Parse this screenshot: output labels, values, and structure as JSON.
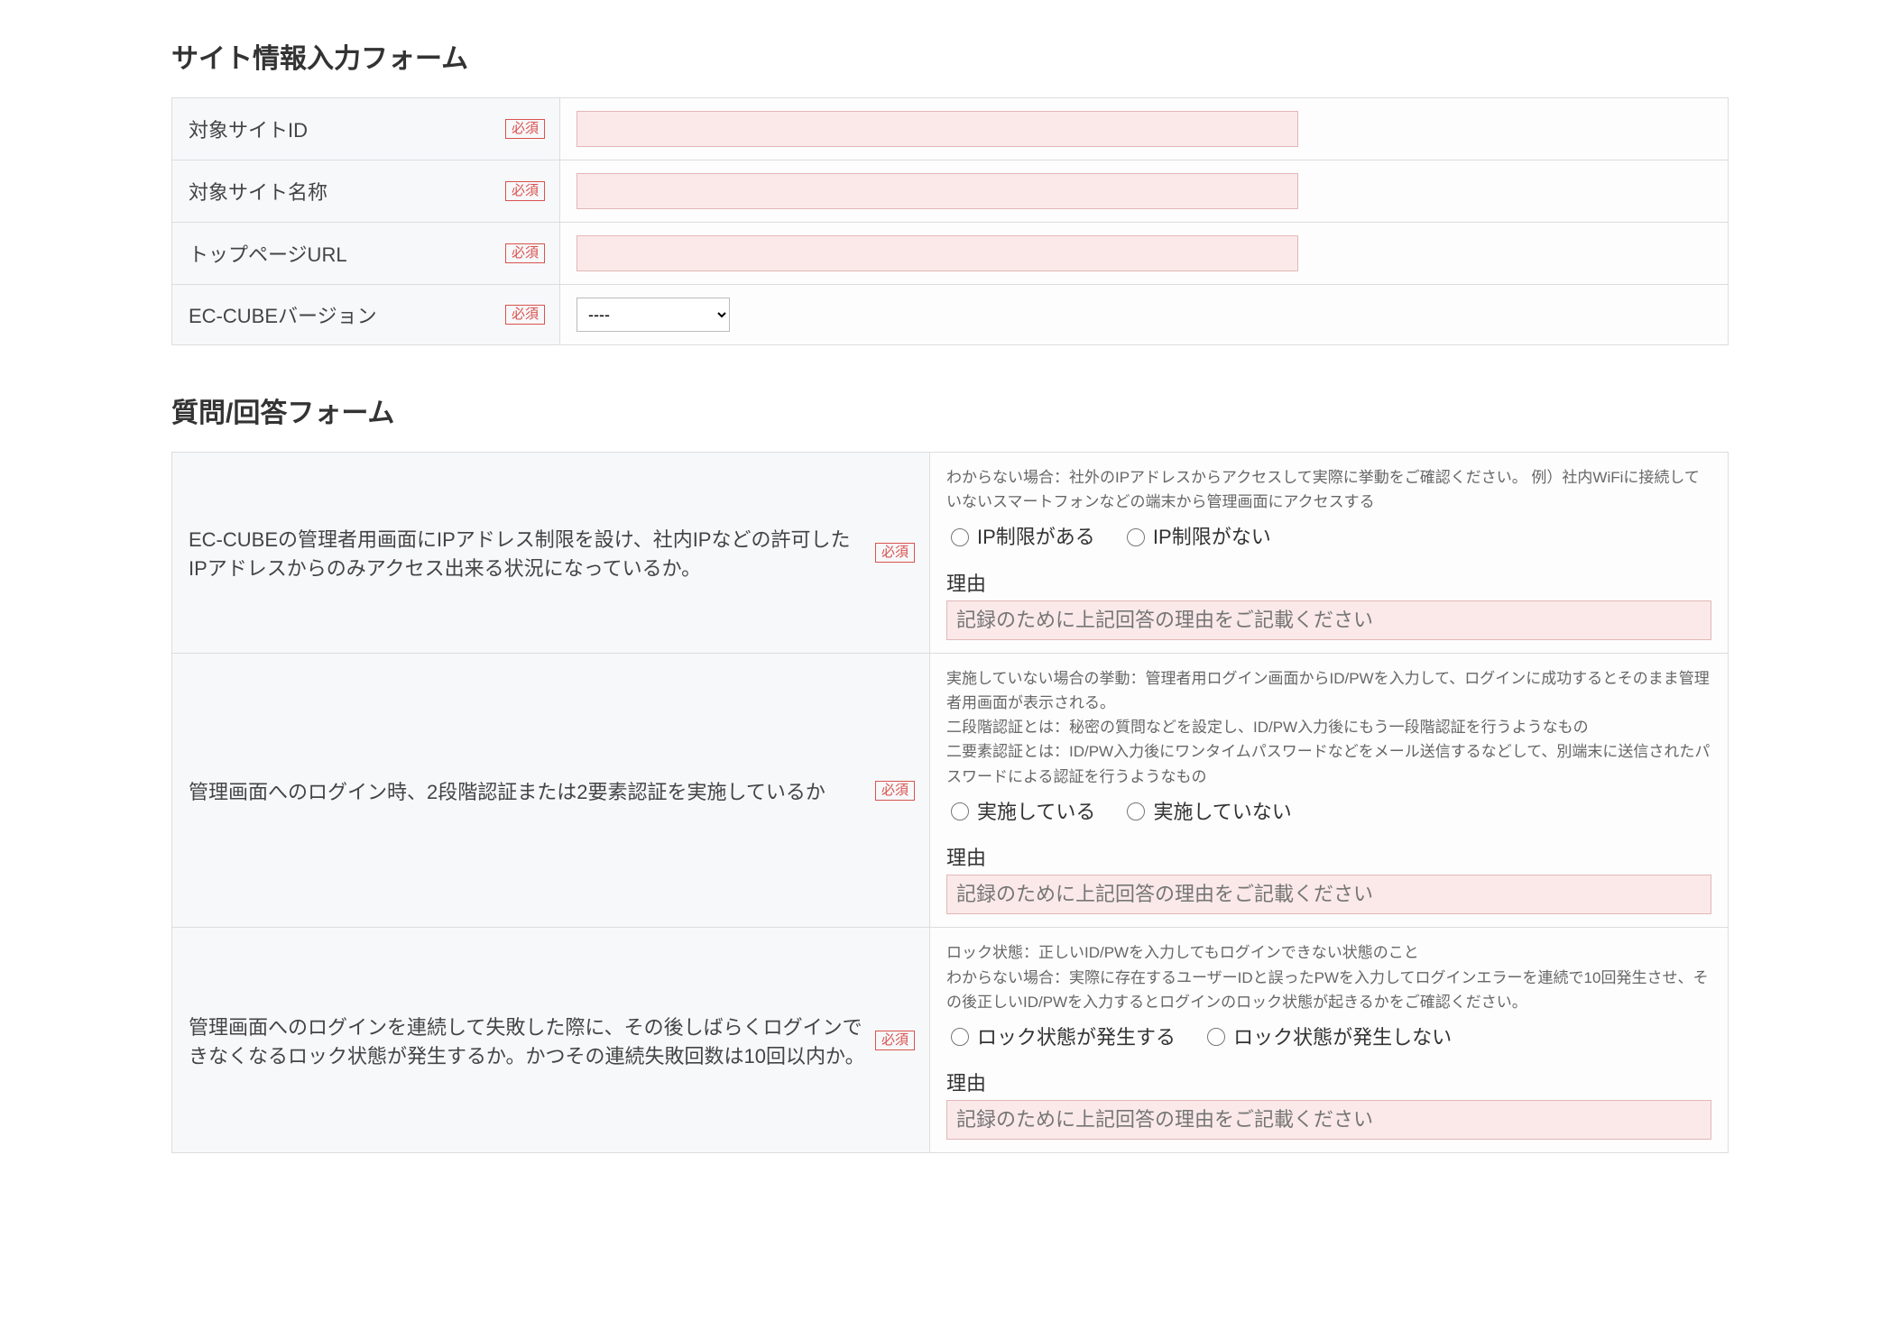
{
  "site_form": {
    "heading": "サイト情報入力フォーム",
    "required_label": "必須",
    "fields": [
      {
        "label": "対象サイトID",
        "type": "text"
      },
      {
        "label": "対象サイト名称",
        "type": "text"
      },
      {
        "label": "トップページURL",
        "type": "text"
      },
      {
        "label": "EC-CUBEバージョン",
        "type": "select",
        "selected": "----"
      }
    ]
  },
  "qa_form": {
    "heading": "質問/回答フォーム",
    "reason_heading": "理由",
    "reason_placeholder": "記録のために上記回答の理由をご記載ください",
    "questions": [
      {
        "text": "EC-CUBEの管理者用画面にIPアドレス制限を設け、社内IPなどの許可したIPアドレスからのみアクセス出来る状況になっているか。",
        "note": "わからない場合：社外のIPアドレスからアクセスして実際に挙動をご確認ください。 例）社内WiFiに接続していないスマートフォンなどの端末から管理画面にアクセスする",
        "options": [
          "IP制限がある",
          "IP制限がない"
        ]
      },
      {
        "text": "管理画面へのログイン時、2段階認証または2要素認証を実施しているか",
        "note": "実施していない場合の挙動：管理者用ログイン画面からID/PWを入力して、ログインに成功するとそのまま管理者用画面が表示される。\n二段階認証とは：秘密の質問などを設定し、ID/PW入力後にもう一段階認証を行うようなもの\n二要素認証とは：ID/PW入力後にワンタイムパスワードなどをメール送信するなどして、別端末に送信されたパスワードによる認証を行うようなもの",
        "options": [
          "実施している",
          "実施していない"
        ]
      },
      {
        "text": "管理画面へのログインを連続して失敗した際に、その後しばらくログインできなくなるロック状態が発生するか。かつその連続失敗回数は10回以内か。",
        "note": "ロック状態：正しいID/PWを入力してもログインできない状態のこと\nわからない場合：実際に存在するユーザーIDと誤ったPWを入力してログインエラーを連続で10回発生させ、その後正しいID/PWを入力するとログインのロック状態が起きるかをご確認ください。",
        "options": [
          "ロック状態が発生する",
          "ロック状態が発生しない"
        ]
      }
    ]
  }
}
